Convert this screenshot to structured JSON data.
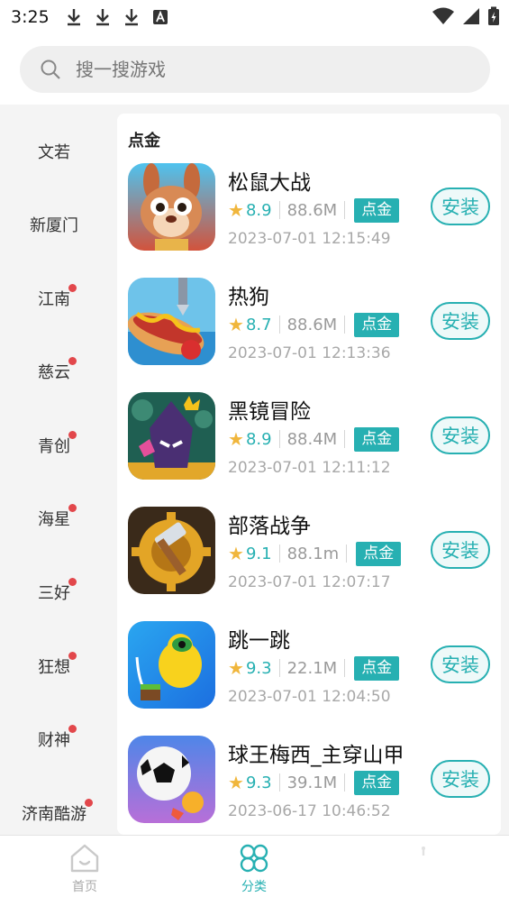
{
  "status_bar": {
    "time": "3:25"
  },
  "search": {
    "placeholder": "搜一搜游戏"
  },
  "sidebar": {
    "items": [
      {
        "label": "文若",
        "dot": false
      },
      {
        "label": "新厦门",
        "dot": false
      },
      {
        "label": "江南",
        "dot": true
      },
      {
        "label": "慈云",
        "dot": true
      },
      {
        "label": "青创",
        "dot": true
      },
      {
        "label": "海星",
        "dot": true
      },
      {
        "label": "三好",
        "dot": true
      },
      {
        "label": "狂想",
        "dot": true
      },
      {
        "label": "财神",
        "dot": true
      },
      {
        "label": "济南酷游",
        "dot": true
      }
    ]
  },
  "section": {
    "title": "点金"
  },
  "games": [
    {
      "name": "松鼠大战",
      "rating": "8.9",
      "size": "88.6M",
      "tag": "点金",
      "date": "2023-07-01 12:15:49",
      "install": "安装"
    },
    {
      "name": "热狗",
      "rating": "8.7",
      "size": "88.6M",
      "tag": "点金",
      "date": "2023-07-01 12:13:36",
      "install": "安装"
    },
    {
      "name": "黑镜冒险",
      "rating": "8.9",
      "size": "88.4M",
      "tag": "点金",
      "date": "2023-07-01 12:11:12",
      "install": "安装"
    },
    {
      "name": "部落战争",
      "rating": "9.1",
      "size": "88.1m",
      "tag": "点金",
      "date": "2023-07-01 12:07:17",
      "install": "安装"
    },
    {
      "name": "跳一跳",
      "rating": "9.3",
      "size": "22.1M",
      "tag": "点金",
      "date": "2023-07-01 12:04:50",
      "install": "安装"
    },
    {
      "name": "球王梅西_主穿山甲",
      "rating": "9.3",
      "size": "39.1M",
      "tag": "点金",
      "date": "2023-06-17 10:46:52",
      "install": "安装"
    }
  ],
  "tabbar": {
    "home": {
      "label": "首页",
      "icon": "home-icon"
    },
    "category": {
      "label": "分类",
      "icon": "category-icon"
    },
    "profile": {
      "icon": "profile-icon"
    }
  },
  "colors": {
    "accent": "#27b0b2",
    "star": "#f0b63c",
    "badge_dot": "#e2474b"
  }
}
